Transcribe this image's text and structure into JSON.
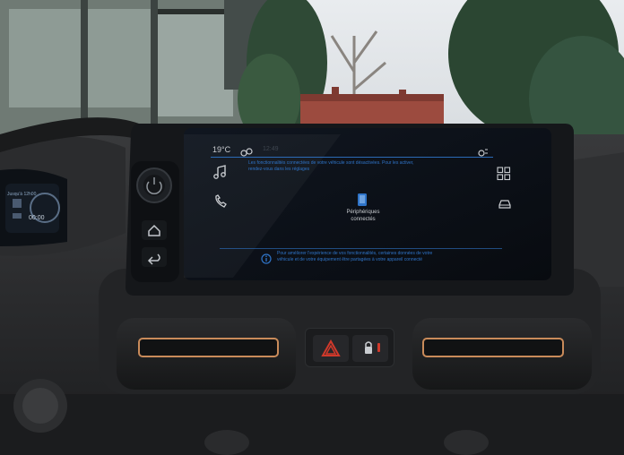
{
  "status_bar": {
    "temperature": "19°C",
    "clock_faint": "12:49"
  },
  "banner": {
    "text_line1": "Les fonctionnalités connectées de votre véhicule sont désactivées. Pour les activer,",
    "text_line2": "rendez-vous dans les réglages"
  },
  "center_tile": {
    "label_line1": "Périphériques",
    "label_line2": "connectés"
  },
  "info_bar": {
    "line1": "Pour améliorer l'expérience de vos fonctionnalités, certaines données de votre",
    "line2": "véhicule et de votre équipement être partagées à votre appareil connecté"
  },
  "cluster": {
    "line1": "Jusqu'à 12h00",
    "line2": "00:00"
  },
  "icons": {
    "music": "music-note-icon",
    "phone": "phone-icon",
    "apps": "apps-grid-icon",
    "car": "car-icon",
    "link": "connection-icon",
    "settings": "settings-icon",
    "home": "home-icon",
    "back": "back-icon",
    "power": "power-volume-knob-icon",
    "info": "info-icon",
    "hazard": "hazard-warning-icon",
    "lock": "door-lock-icon"
  },
  "colors": {
    "screen_bg": "#0c1118",
    "accent_blue": "#2f74c8",
    "text_white": "#d8dde4",
    "hazard_red": "#d0392b"
  }
}
